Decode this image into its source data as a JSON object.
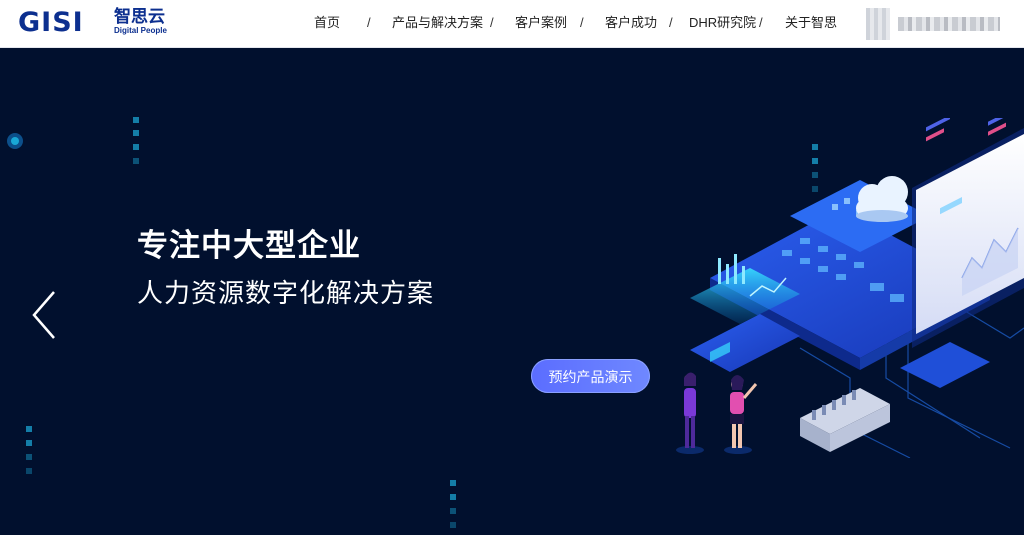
{
  "logo": {
    "mark": "GISI",
    "name_cn": "智思云",
    "name_en": "Digital People"
  },
  "nav": {
    "items": [
      "首页",
      "产品与解决方案",
      "客户案例",
      "客户成功",
      "DHR研究院",
      "关于智思"
    ],
    "separator": "/"
  },
  "user": {
    "name": "████████"
  },
  "hero": {
    "title": "专注中大型企业",
    "subtitle": "人力资源数字化解决方案",
    "cta_label": "预约产品演示"
  },
  "icons": {
    "prev": "chevron-left-icon"
  },
  "colors": {
    "brand": "#0c2f8f",
    "hero_bg": "#01102e",
    "accent": "#147ea8",
    "button": "#6275ff"
  }
}
